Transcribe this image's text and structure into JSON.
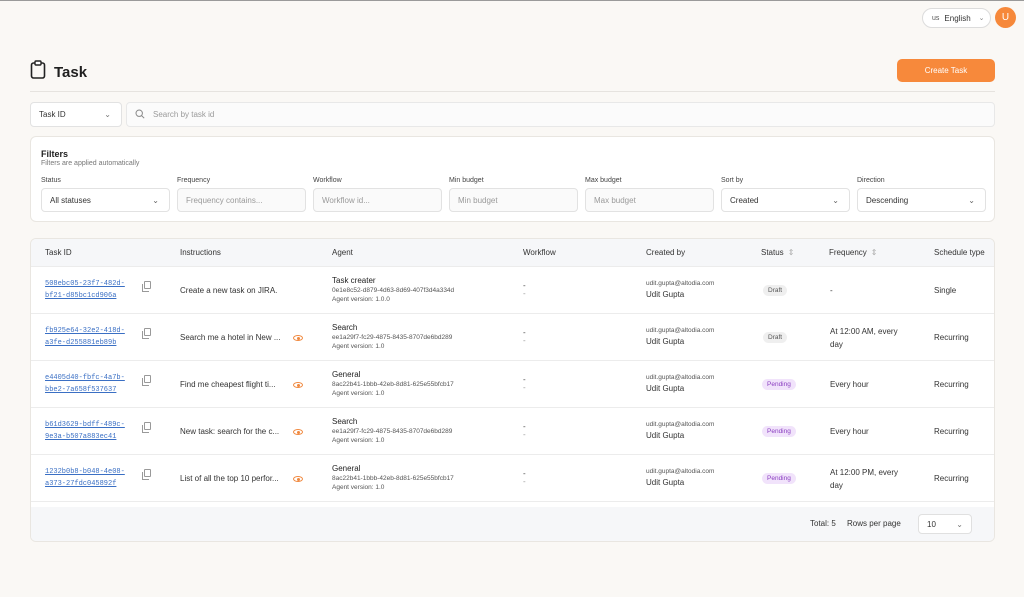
{
  "header": {
    "language": {
      "flag": "us",
      "label": "English"
    },
    "avatar_initial": "U"
  },
  "page": {
    "title": "Task",
    "create_button": "Create Task"
  },
  "search": {
    "field_select": "Task ID",
    "placeholder": "Search by task id"
  },
  "filters": {
    "title": "Filters",
    "subtitle": "Filters are applied automatically",
    "fields": [
      {
        "label": "Status",
        "value": "All statuses",
        "type": "select"
      },
      {
        "label": "Frequency",
        "placeholder": "Frequency contains...",
        "type": "input"
      },
      {
        "label": "Workflow",
        "placeholder": "Workflow id...",
        "type": "input"
      },
      {
        "label": "Min budget",
        "placeholder": "Min budget",
        "type": "input"
      },
      {
        "label": "Max budget",
        "placeholder": "Max budget",
        "type": "input"
      },
      {
        "label": "Sort by",
        "value": "Created",
        "type": "select"
      },
      {
        "label": "Direction",
        "value": "Descending",
        "type": "select"
      }
    ]
  },
  "table": {
    "columns": [
      "Task ID",
      "Instructions",
      "Agent",
      "Workflow",
      "Created by",
      "Status",
      "Frequency",
      "Schedule type"
    ],
    "rows": [
      {
        "task_id_1": "508ebc05-23f7-482d-",
        "task_id_2": "bf21-d85bc1cd906a",
        "instructions": "Create a new task on JIRA.",
        "agent_name": "Task creater",
        "agent_id": "0e1e8c52-d879-4d63-8d69-407f3d4a334d",
        "agent_version": "Agent version: 1.0.0",
        "workflow_1": "-",
        "workflow_2": "-",
        "email": "udit.gupta@altodia.com",
        "user": "Udit Gupta",
        "status": "Draft",
        "frequency_1": "-",
        "frequency_2": "",
        "schedule": "Single"
      },
      {
        "task_id_1": "fb925e64-32e2-418d-",
        "task_id_2": "a3fe-d255881eb89b",
        "instructions": "Search me a hotel in New ...",
        "agent_name": "Search",
        "agent_id": "ee1a29f7-fc29-4875-8435-8707de6bd289",
        "agent_version": "Agent version: 1.0",
        "workflow_1": "-",
        "workflow_2": "-",
        "email": "udit.gupta@altodia.com",
        "user": "Udit Gupta",
        "status": "Draft",
        "frequency_1": "At 12:00 AM, every",
        "frequency_2": "day",
        "schedule": "Recurring"
      },
      {
        "task_id_1": "e4405d40-fbfc-4a7b-",
        "task_id_2": "bbe2-7a658f537637",
        "instructions": "Find me cheapest flight ti...",
        "agent_name": "General",
        "agent_id": "8ac22b41-1bbb-42eb-8d81-625e55bfcb17",
        "agent_version": "Agent version: 1.0",
        "workflow_1": "-",
        "workflow_2": "-",
        "email": "udit.gupta@altodia.com",
        "user": "Udit Gupta",
        "status": "Pending",
        "frequency_1": "Every hour",
        "frequency_2": "",
        "schedule": "Recurring"
      },
      {
        "task_id_1": "b61d3629-bdff-489c-",
        "task_id_2": "9e3a-b507a883ec41",
        "instructions": "New task: search for the c...",
        "agent_name": "Search",
        "agent_id": "ee1a29f7-fc29-4875-8435-8707de6bd289",
        "agent_version": "Agent version: 1.0",
        "workflow_1": "-",
        "workflow_2": "-",
        "email": "udit.gupta@altodia.com",
        "user": "Udit Gupta",
        "status": "Pending",
        "frequency_1": "Every hour",
        "frequency_2": "",
        "schedule": "Recurring"
      },
      {
        "task_id_1": "1232b0b8-b048-4e08-",
        "task_id_2": "a373-27fdc045892f",
        "instructions": "List of all the top 10 perfor...",
        "agent_name": "General",
        "agent_id": "8ac22b41-1bbb-42eb-8d81-625e55bfcb17",
        "agent_version": "Agent version: 1.0",
        "workflow_1": "-",
        "workflow_2": "-",
        "email": "udit.gupta@altodia.com",
        "user": "Udit Gupta",
        "status": "Pending",
        "frequency_1": "At 12:00 PM, every",
        "frequency_2": "day",
        "schedule": "Recurring"
      }
    ]
  },
  "pagination": {
    "total": "Total: 5",
    "rows_per_page_label": "Rows per page",
    "rows_per_page": "10"
  },
  "colors": {
    "accent": "#f7893b",
    "link": "#3a6fc4",
    "pending_bg": "#f1e3fb",
    "pending_text": "#8a3ec0",
    "draft_bg": "#efefef"
  },
  "icons": {
    "title": "clipboard-icon",
    "search": "search-icon",
    "copy": "copy-icon",
    "view": "eye-icon",
    "sort": "sort-icon",
    "dropdown": "chevron-down-icon"
  }
}
